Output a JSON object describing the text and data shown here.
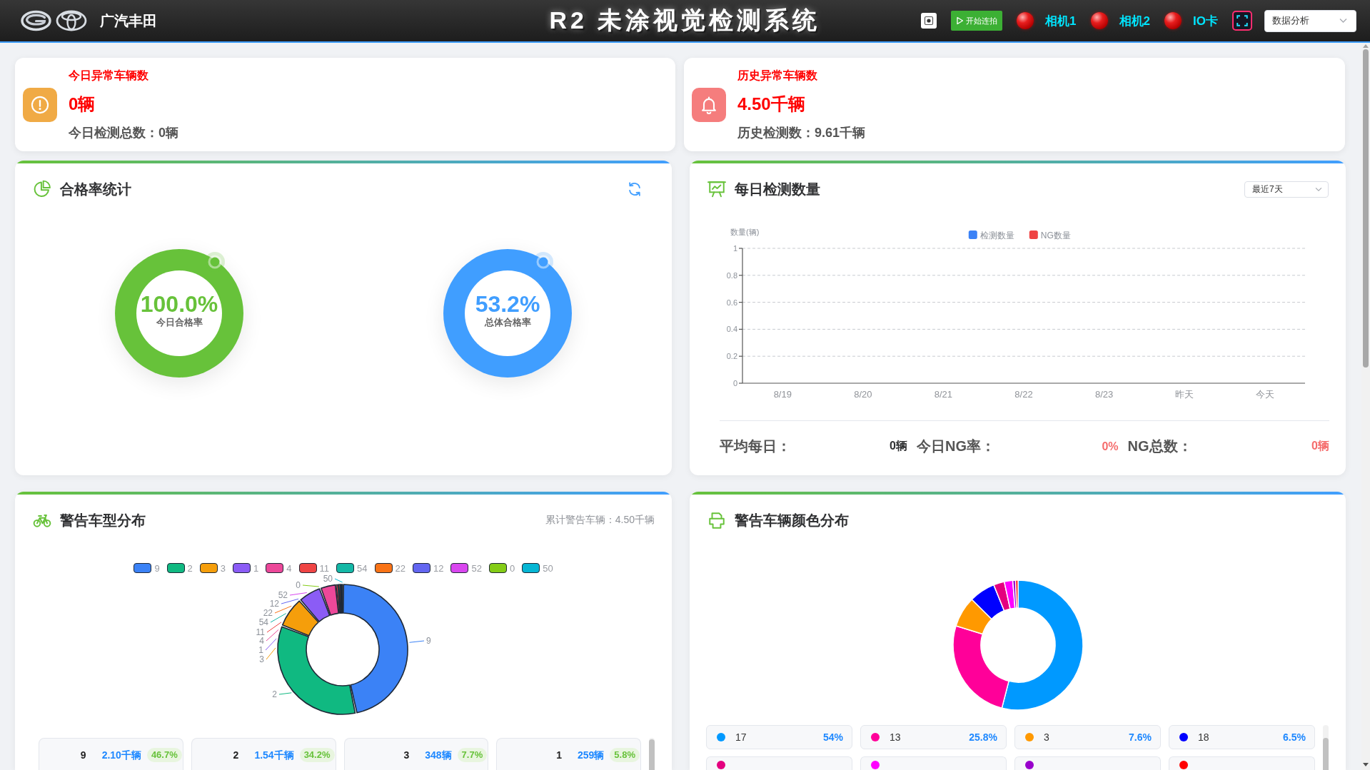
{
  "header": {
    "brand": "广汽丰田",
    "title": "R2 未涂视觉检测系统",
    "start_button": "开始连拍",
    "devices": [
      {
        "label": "相机1",
        "online": false
      },
      {
        "label": "相机2",
        "online": false
      },
      {
        "label": "IO卡",
        "online": false
      }
    ],
    "view_select": {
      "value": "数据分析"
    }
  },
  "summary_cards": [
    {
      "kind": "today",
      "title": "今日异常车辆数",
      "value": "0辆",
      "detail": "今日检测总数：0辆"
    },
    {
      "kind": "history",
      "title": "历史异常车辆数",
      "value": "4.50千辆",
      "detail": "历史检测数：9.61千辆"
    }
  ],
  "rate_panel": {
    "title": "合格率统计",
    "gauges": [
      {
        "value": "100.0%",
        "label": "今日合格率",
        "color": "#67c23a"
      },
      {
        "value": "53.2%",
        "label": "总体合格率",
        "color": "#409eff"
      }
    ]
  },
  "daily_panel": {
    "title": "每日检测数量",
    "range_select": {
      "value": "最近7天"
    },
    "chart_data": {
      "type": "bar",
      "ylabel": "数量(辆)",
      "categories": [
        "8/19",
        "8/20",
        "8/21",
        "8/22",
        "8/23",
        "昨天",
        "今天"
      ],
      "series": [
        {
          "name": "检测数量",
          "color": "#3b82f6",
          "values": [
            0,
            0,
            0,
            0,
            0,
            0,
            0
          ]
        },
        {
          "name": "NG数量",
          "color": "#ef4444",
          "values": [
            0,
            0,
            0,
            0,
            0,
            0,
            0
          ]
        }
      ],
      "ylim": [
        0,
        1
      ],
      "yticks": [
        0,
        0.2,
        0.4,
        0.6,
        0.8,
        1
      ],
      "grid": true
    },
    "stats": [
      {
        "label": "平均每日：",
        "value": "0辆",
        "kind": "normal"
      },
      {
        "label": "今日NG率：",
        "value": "0%",
        "kind": "alert"
      },
      {
        "label": "NG总数：",
        "value": "0辆",
        "kind": "alert"
      }
    ]
  },
  "model_panel": {
    "title": "警告车型分布",
    "total": "累计警告车辆：4.50千辆",
    "legend": [
      {
        "label": "9",
        "color": "#3b82f6"
      },
      {
        "label": "2",
        "color": "#10b981"
      },
      {
        "label": "3",
        "color": "#f59e0b"
      },
      {
        "label": "1",
        "color": "#8b5cf6"
      },
      {
        "label": "4",
        "color": "#ec4899"
      },
      {
        "label": "11",
        "color": "#ef4444"
      },
      {
        "label": "54",
        "color": "#14b8a6"
      },
      {
        "label": "22",
        "color": "#f97316"
      },
      {
        "label": "12",
        "color": "#6366f1"
      },
      {
        "label": "52",
        "color": "#d946ef"
      },
      {
        "label": "0",
        "color": "#84cc16"
      },
      {
        "label": "50",
        "color": "#06b6d4"
      }
    ],
    "slice_labels": [
      "50",
      "0",
      "52",
      "12",
      "22",
      "54",
      "11",
      "4",
      "9",
      "1",
      "3",
      "2"
    ],
    "stats": [
      {
        "name": "9",
        "count": "2.10千辆",
        "share": "46.7%"
      },
      {
        "name": "2",
        "count": "1.54千辆",
        "share": "34.2%"
      },
      {
        "name": "3",
        "count": "348辆",
        "share": "7.7%"
      },
      {
        "name": "1",
        "count": "259辆",
        "share": "5.8%"
      }
    ]
  },
  "color_panel": {
    "title": "警告车辆颜色分布",
    "items": [
      {
        "label": "17",
        "share": "54%",
        "color": "#0099ff"
      },
      {
        "label": "13",
        "share": "25.8%",
        "color": "#ff0099"
      },
      {
        "label": "3",
        "share": "7.6%",
        "color": "#ff9900"
      },
      {
        "label": "18",
        "share": "6.5%",
        "color": "#0000ff"
      },
      {
        "color": "#e4007f"
      },
      {
        "color": "#ff00ff"
      },
      {
        "color": "#9900cc"
      },
      {
        "color": "#ff0000"
      }
    ]
  }
}
